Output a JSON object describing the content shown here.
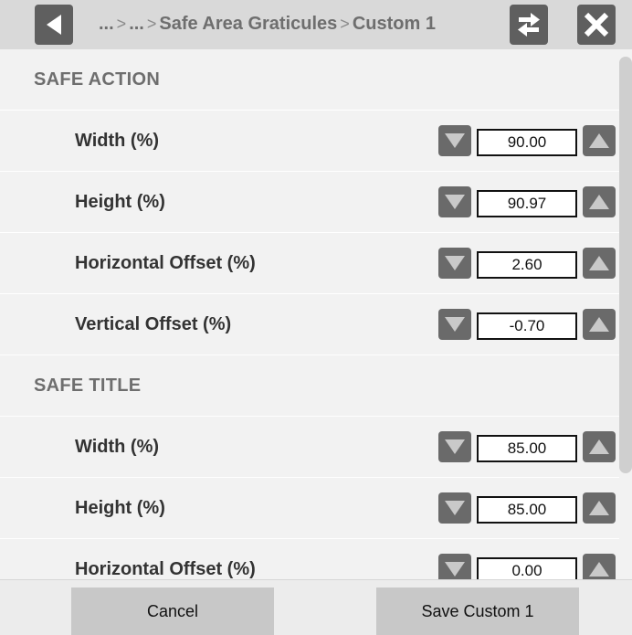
{
  "header": {
    "breadcrumb": [
      "...",
      "...",
      "Safe Area Graticules",
      "Custom 1"
    ],
    "separator": ">",
    "icons": {
      "back": "back-arrow-icon",
      "swap": "swap-arrows-icon",
      "close": "close-x-icon"
    }
  },
  "sections": [
    {
      "title": "SAFE ACTION",
      "rows": [
        {
          "label": "Width (%)",
          "value": "90.00"
        },
        {
          "label": "Height (%)",
          "value": "90.97"
        },
        {
          "label": "Horizontal Offset (%)",
          "value": "2.60"
        },
        {
          "label": "Vertical Offset (%)",
          "value": "-0.70"
        }
      ]
    },
    {
      "title": "SAFE TITLE",
      "rows": [
        {
          "label": "Width (%)",
          "value": "85.00"
        },
        {
          "label": "Height (%)",
          "value": "85.00"
        },
        {
          "label": "Horizontal Offset (%)",
          "value": "0.00"
        }
      ]
    }
  ],
  "footer": {
    "cancel_label": "Cancel",
    "save_label": "Save Custom 1"
  },
  "colors": {
    "header_bg": "#d9d9d9",
    "button_dark": "#5f5f5f",
    "content_bg": "#f2f2f2",
    "footer_button": "#c8c8c8"
  }
}
